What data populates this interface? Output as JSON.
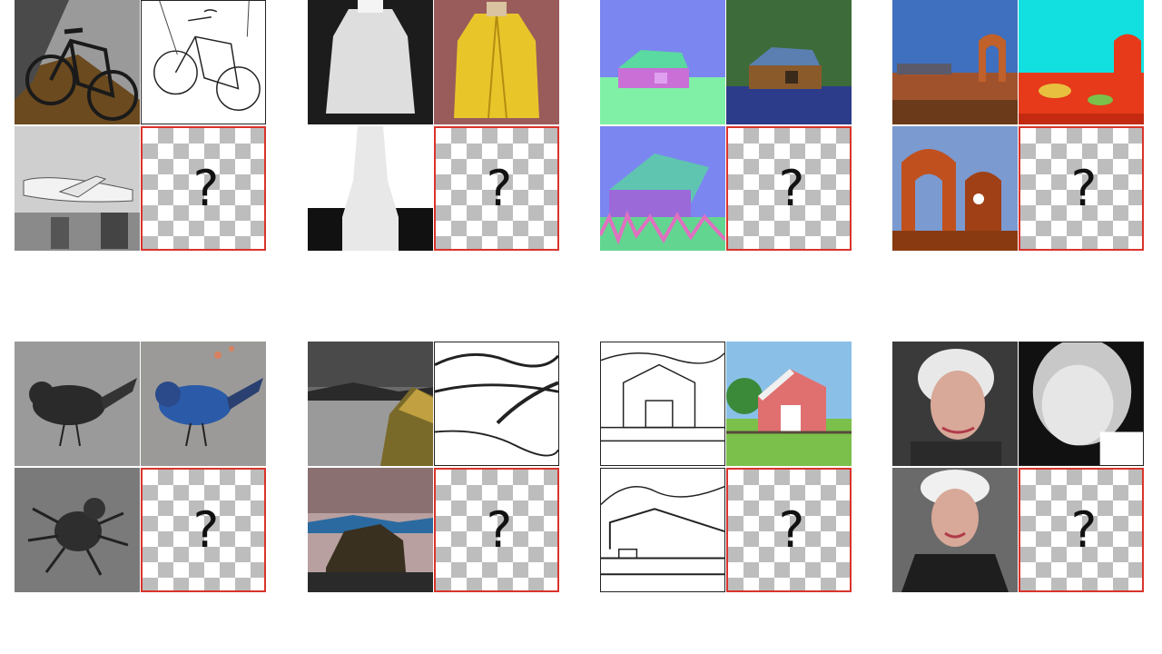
{
  "query_symbol": "?",
  "accent_color": "#d9342b",
  "puzzles": [
    {
      "name": "bicycle-edges"
    },
    {
      "name": "coat-depth"
    },
    {
      "name": "cabin-normals"
    },
    {
      "name": "arches-segmentation"
    },
    {
      "name": "bird-colorization"
    },
    {
      "name": "coast-edges"
    },
    {
      "name": "barn-sketch"
    },
    {
      "name": "portrait-depth"
    }
  ]
}
